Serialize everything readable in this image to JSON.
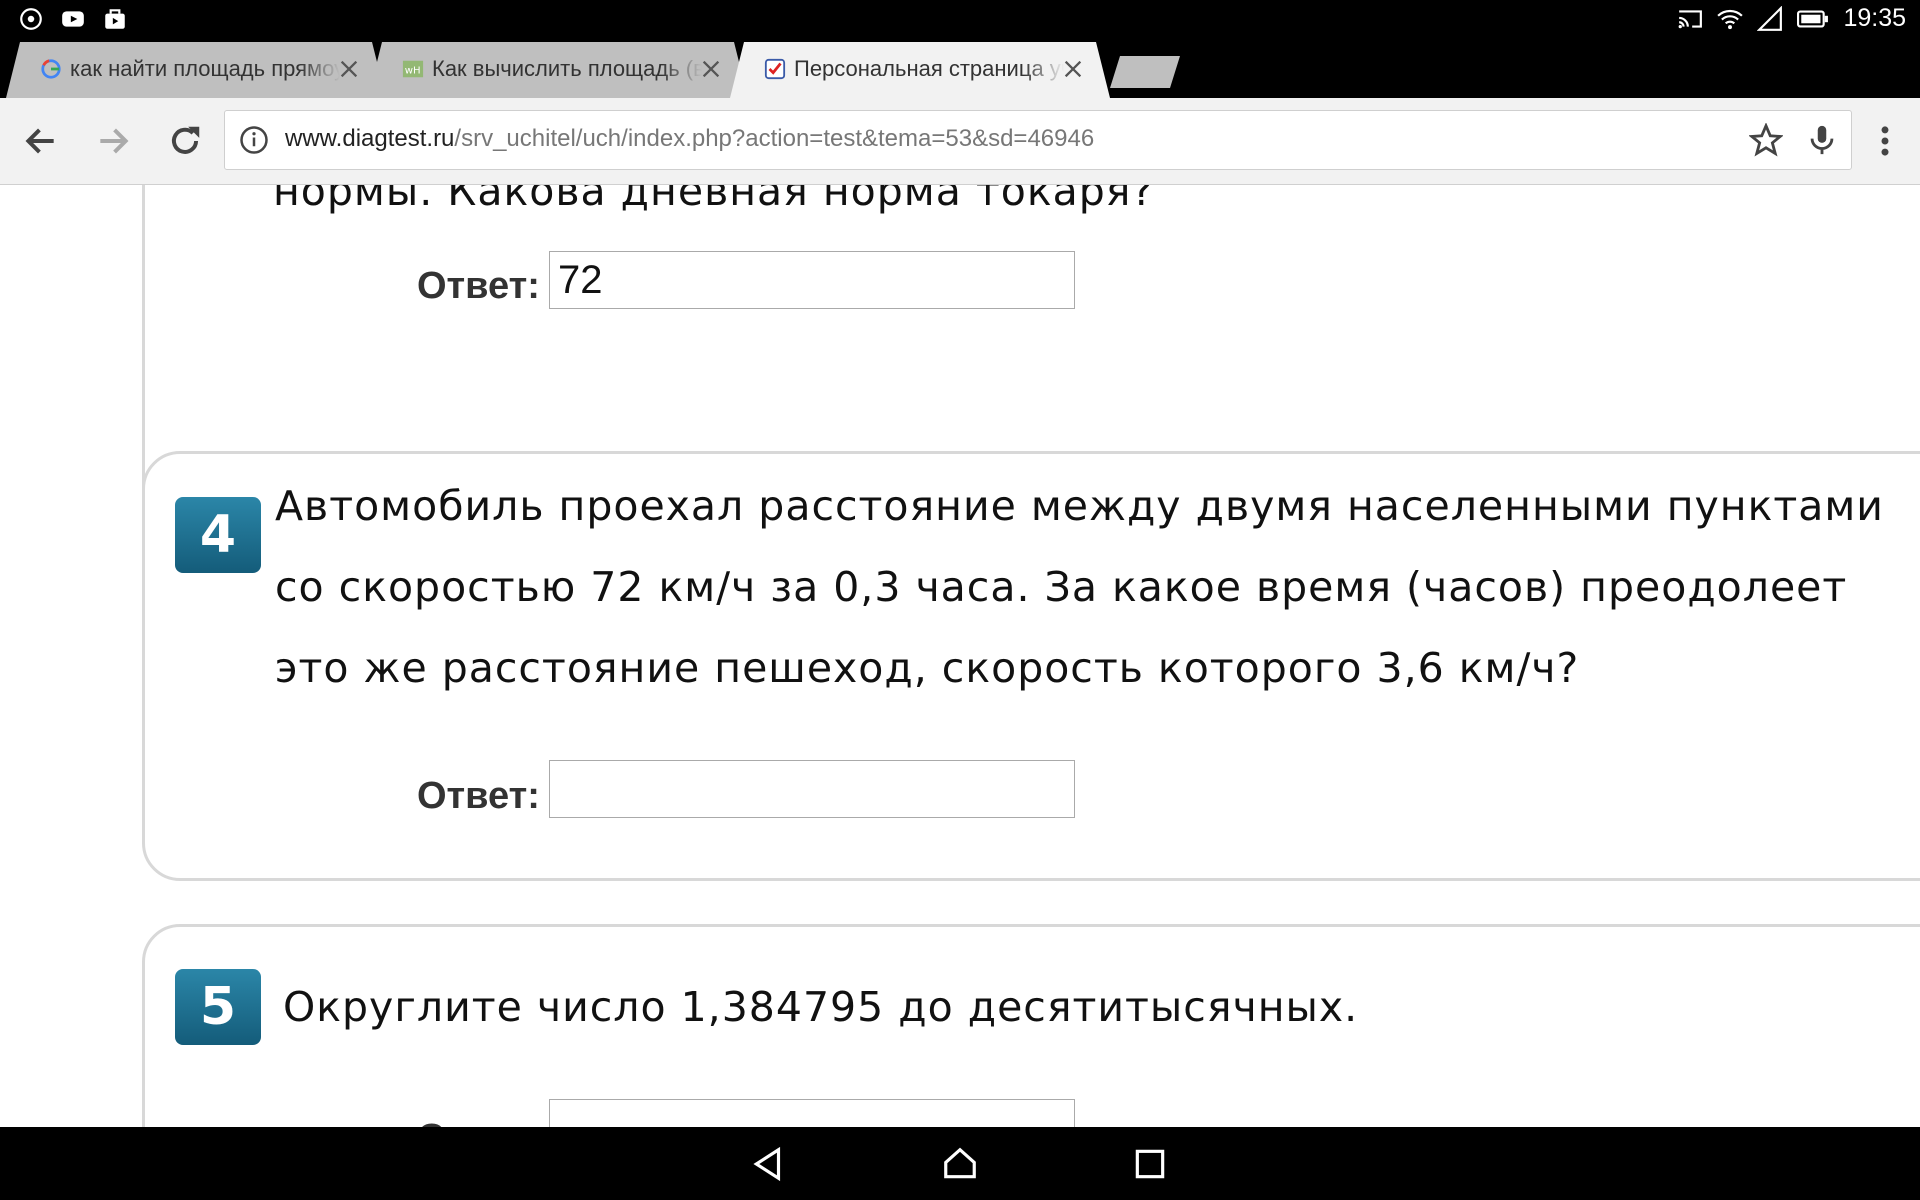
{
  "status_bar": {
    "time": "19:35",
    "left_icons": [
      "radio-icon",
      "youtube-icon",
      "bag-icon"
    ],
    "right_icons": [
      "cast-icon",
      "wifi-icon",
      "signal-icon",
      "battery-icon"
    ]
  },
  "tabs": [
    {
      "title": "как найти площадь прямоугольника",
      "favicon": "google-favicon",
      "active": false
    },
    {
      "title": "Как вычислить площадь (в квадратных",
      "favicon": "wikihow-favicon",
      "active": false
    },
    {
      "title": "Персональная страница участника",
      "favicon": "diagtest-favicon",
      "active": true
    }
  ],
  "toolbar": {
    "url_host": "www.diagtest.ru",
    "url_path": "/srv_uchitel/uch/index.php?action=test&tema=53&sd=46946"
  },
  "questions": [
    {
      "text_lines": [
        "нормы. Какова дневная норма токаря?"
      ],
      "answer_label": "Ответ:",
      "answer_value": "72"
    },
    {
      "number": "4",
      "text_lines": [
        "Автомобиль проехал расстояние между двумя населенными пунктами",
        "со скоростью 72 км/ч за 0,3 часа. За какое время (часов) преодолеет",
        "это же расстояние пешеход, скорость которого 3,6 км/ч?"
      ],
      "answer_label": "Ответ:",
      "answer_value": ""
    },
    {
      "number": "5",
      "text_lines": [
        "Округлите число 1,384795  до десятитысячных."
      ],
      "answer_label": "Ответ:",
      "answer_value": ""
    }
  ]
}
